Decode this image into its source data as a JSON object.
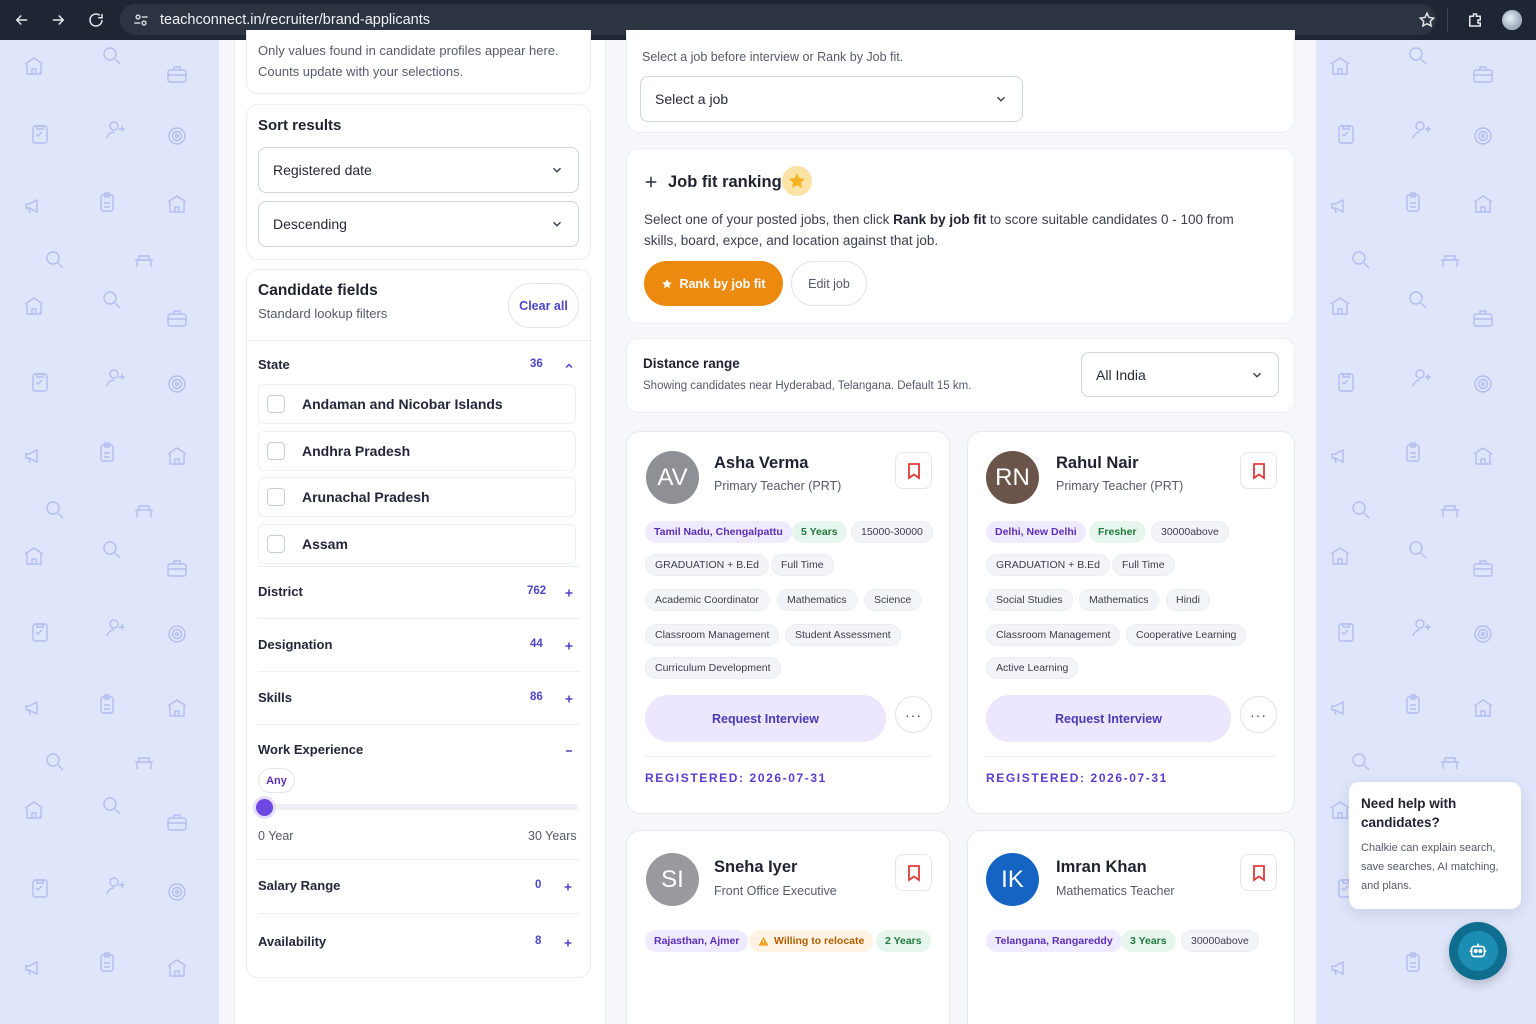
{
  "browser": {
    "url": "teachconnect.in/recruiter/brand-applicants"
  },
  "filters": {
    "info_line1": "Only values found in candidate profiles appear here.",
    "info_line2": "Counts update with your selections.",
    "sort": {
      "title": "Sort results",
      "by": "Registered date",
      "order": "Descending"
    },
    "candidate_fields": {
      "title": "Candidate fields",
      "subtitle": "Standard lookup filters",
      "clear_label": "Clear all"
    },
    "state": {
      "label": "State",
      "count": "36",
      "items": [
        "Andaman and Nicobar Islands",
        "Andhra Pradesh",
        "Arunachal Pradesh",
        "Assam"
      ]
    },
    "district": {
      "label": "District",
      "count": "762"
    },
    "designation": {
      "label": "Designation",
      "count": "44"
    },
    "skills": {
      "label": "Skills",
      "count": "86"
    },
    "work_experience": {
      "label": "Work Experience",
      "value_label": "Any",
      "value": 0,
      "min_label": "0 Year",
      "max_label": "30 Years"
    },
    "salary_range": {
      "label": "Salary Range",
      "count": "0"
    },
    "availability": {
      "label": "Availability",
      "count": "8"
    }
  },
  "job_select": {
    "hint": "Select a job before interview or Rank by Job fit.",
    "placeholder": "Select a job"
  },
  "job_fit": {
    "title": "Job fit ranking",
    "desc_a": "Select one of your posted jobs, then click ",
    "desc_bold": "Rank by job fit",
    "desc_b": " to score suitable candidates 0 - 100 from",
    "desc_line2": "skills, board, exрce, and location against that job.",
    "rank_label": "Rank by job fit",
    "edit_label": "Edit job"
  },
  "distance": {
    "title": "Distance range",
    "desc": "Showing candidates near Hyderabad, Telangana. Default 15 km.",
    "value": "All India"
  },
  "candidates": [
    {
      "initials": "AV",
      "name": "Asha Verma",
      "role": "Primary Teacher (PRT)",
      "tags": [
        "Tamil Nadu, Chengalpattu",
        "5 Years",
        "15000-30000",
        "GRADUATION + B.Ed",
        "Full Time",
        "Academic Coordinator",
        "Mathematics",
        "Science",
        "Classroom Management",
        "Student Assessment",
        "Curriculum Development"
      ],
      "request_label": "Request Interview",
      "registered": "REGISTERED: 2026-07-31"
    },
    {
      "initials": "RN",
      "name": "Rahul Nair",
      "role": "Primary Teacher (PRT)",
      "tags": [
        "Delhi, New Delhi",
        "Fresher",
        "30000above",
        "GRADUATION + B.Ed",
        "Full Time",
        "Social Studies",
        "Mathematics",
        "Hindi",
        "Classroom Management",
        "Cooperative Learning",
        "Active Learning"
      ],
      "request_label": "Request Interview",
      "registered": "REGISTERED: 2026-07-31"
    },
    {
      "initials": "SI",
      "name": "Sneha Iyer",
      "role": "Front Office Executive",
      "tags": [
        "Rajasthan, Ajmer",
        "Willing to relocate",
        "2 Years"
      ]
    },
    {
      "initials": "IK",
      "name": "Imran Khan",
      "role": "Mathematics Teacher",
      "tags": [
        "Telangana, Rangareddy",
        "3 Years",
        "30000above"
      ]
    }
  ],
  "help": {
    "title": "Need help with candidates?",
    "text": "Chalkie can explain search, save searches, AI matching, and plans."
  },
  "colors": {
    "accent": "#4b46c9",
    "rank_button": "#ec8a10",
    "avatar_av": "#8f9095",
    "avatar_rn": "#6b5449",
    "avatar_si": "#9a9a9e",
    "avatar_ik": "#1563c3"
  }
}
